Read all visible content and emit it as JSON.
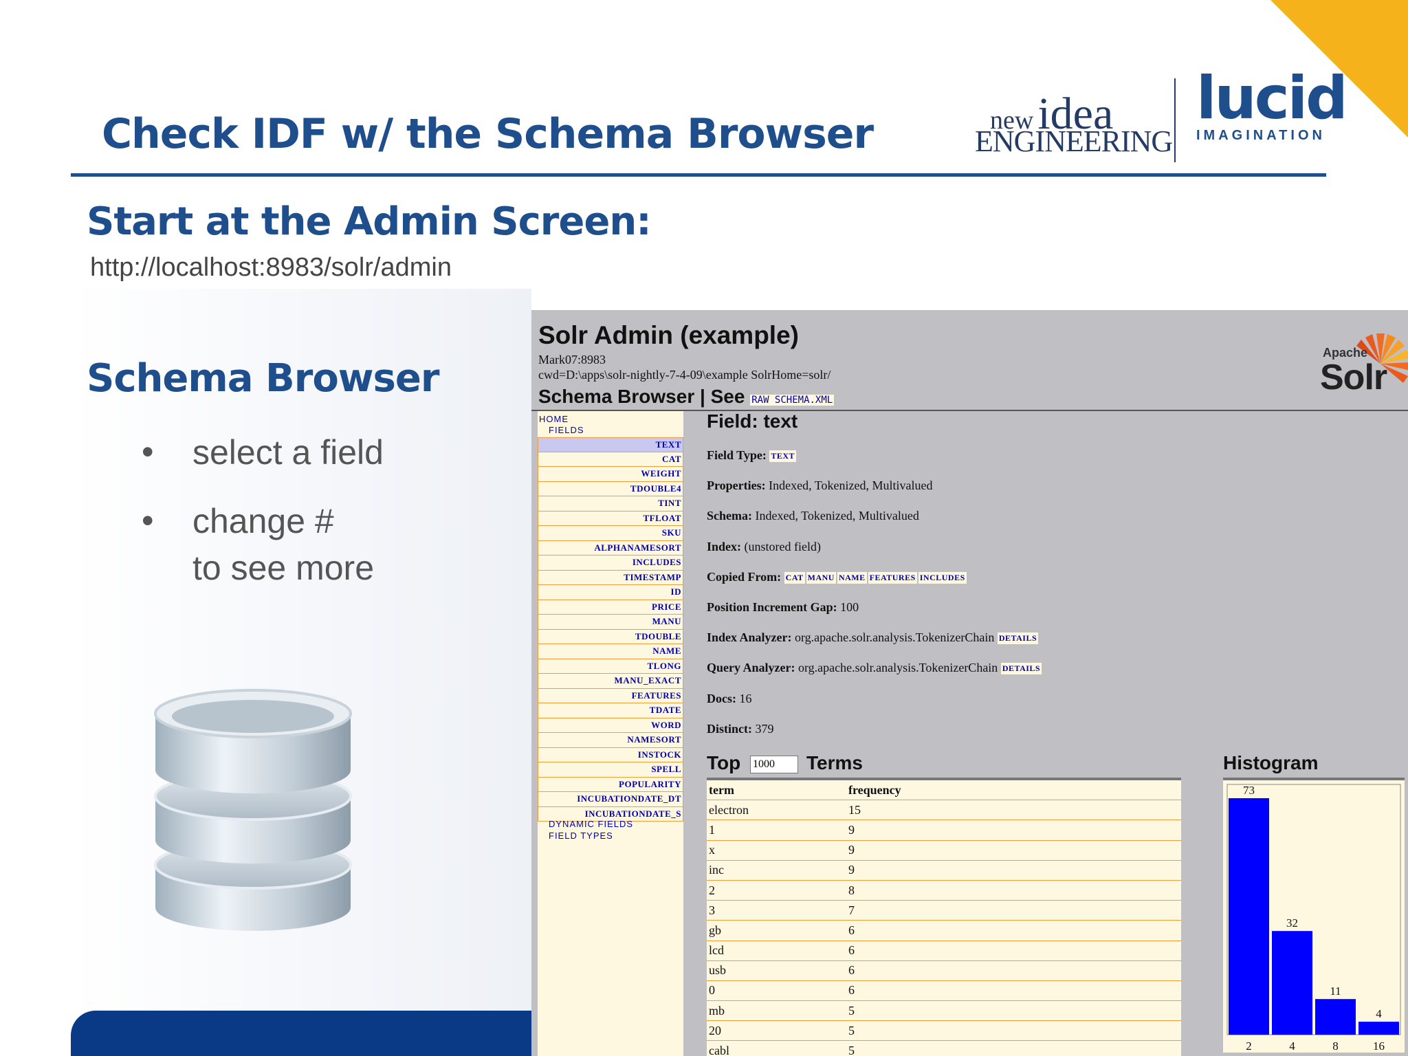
{
  "slide": {
    "title": "Check IDF w/ the Schema Browser",
    "section_heading": "Start at the Admin Screen:",
    "admin_url": "http://localhost:8983/solr/admin",
    "sub_heading": "Schema Browser",
    "bullets": [
      "select a field",
      "change #\nto see more"
    ],
    "bullet_glyph": "•",
    "logo_nie": {
      "new": "new",
      "idea": "idea",
      "engineering": "ENGINEERING"
    },
    "logo_lucid": {
      "word": "lucid",
      "sub": "IMAGINATION"
    },
    "colors": {
      "title_blue": "#1f4e8c",
      "accent_orange": "#f6b21b",
      "footer_navy": "#0a3a85"
    }
  },
  "solr": {
    "title": "Solr Admin (example)",
    "host": "Mark07:8983",
    "cwd": "cwd=D:\\apps\\solr-nightly-7-4-09\\example SolrHome=solr/",
    "schema_browser_label": "Schema Browser | See",
    "raw_schema_link": "RAW SCHEMA.XML",
    "logo_apache": "Apache",
    "logo_solr": "Solr",
    "nav": {
      "home": "HOME",
      "fields": "FIELDS",
      "field_items": [
        "TEXT",
        "CAT",
        "WEIGHT",
        "TDOUBLE4",
        "TINT",
        "TFLOAT",
        "SKU",
        "ALPHANAMESORT",
        "INCLUDES",
        "TIMESTAMP",
        "ID",
        "PRICE",
        "MANU",
        "TDOUBLE",
        "NAME",
        "TLONG",
        "MANU_EXACT",
        "FEATURES",
        "TDATE",
        "WORD",
        "NAMESORT",
        "INSTOCK",
        "SPELL",
        "POPULARITY",
        "INCUBATIONDATE_DT",
        "INCUBATIONDATE_S"
      ],
      "dynamic_fields": "DYNAMIC FIELDS",
      "field_types": "FIELD TYPES"
    },
    "field": {
      "heading": "Field: text",
      "field_type_label": "Field Type:",
      "field_type_value": "TEXT",
      "properties_label": "Properties:",
      "properties_value": "Indexed, Tokenized, Multivalued",
      "schema_label": "Schema:",
      "schema_value": "Indexed, Tokenized, Multivalued",
      "index_label": "Index:",
      "index_value": "(unstored field)",
      "copied_from_label": "Copied From:",
      "copied_from": [
        "CAT",
        "MANU",
        "NAME",
        "FEATURES",
        "INCLUDES"
      ],
      "pig_label": "Position Increment Gap:",
      "pig_value": "100",
      "index_analyzer_label": "Index Analyzer:",
      "index_analyzer_value": "org.apache.solr.analysis.TokenizerChain",
      "query_analyzer_label": "Query Analyzer:",
      "query_analyzer_value": "org.apache.solr.analysis.TokenizerChain",
      "details_link": "DETAILS",
      "docs_label": "Docs:",
      "docs_value": "16",
      "distinct_label": "Distinct:",
      "distinct_value": "379"
    },
    "top_terms": {
      "top_label": "Top",
      "count_value": "1000",
      "terms_label": "Terms",
      "header": {
        "term": "term",
        "frequency": "frequency"
      },
      "rows": [
        {
          "term": "electron",
          "frequency": "15"
        },
        {
          "term": "1",
          "frequency": "9"
        },
        {
          "term": "x",
          "frequency": "9"
        },
        {
          "term": "inc",
          "frequency": "9"
        },
        {
          "term": "2",
          "frequency": "8"
        },
        {
          "term": "3",
          "frequency": "7"
        },
        {
          "term": "gb",
          "frequency": "6"
        },
        {
          "term": "lcd",
          "frequency": "6"
        },
        {
          "term": "usb",
          "frequency": "6"
        },
        {
          "term": "0",
          "frequency": "6"
        },
        {
          "term": "mb",
          "frequency": "5"
        },
        {
          "term": "20",
          "frequency": "5"
        },
        {
          "term": "cabl",
          "frequency": "5"
        }
      ]
    },
    "histogram_label": "Histogram"
  },
  "chart_data": {
    "type": "bar",
    "title": "Histogram",
    "categories": [
      "2",
      "4",
      "8",
      "16"
    ],
    "values": [
      73,
      32,
      11,
      4
    ],
    "ylim": [
      0,
      73
    ],
    "bar_color": "#0000ff"
  }
}
